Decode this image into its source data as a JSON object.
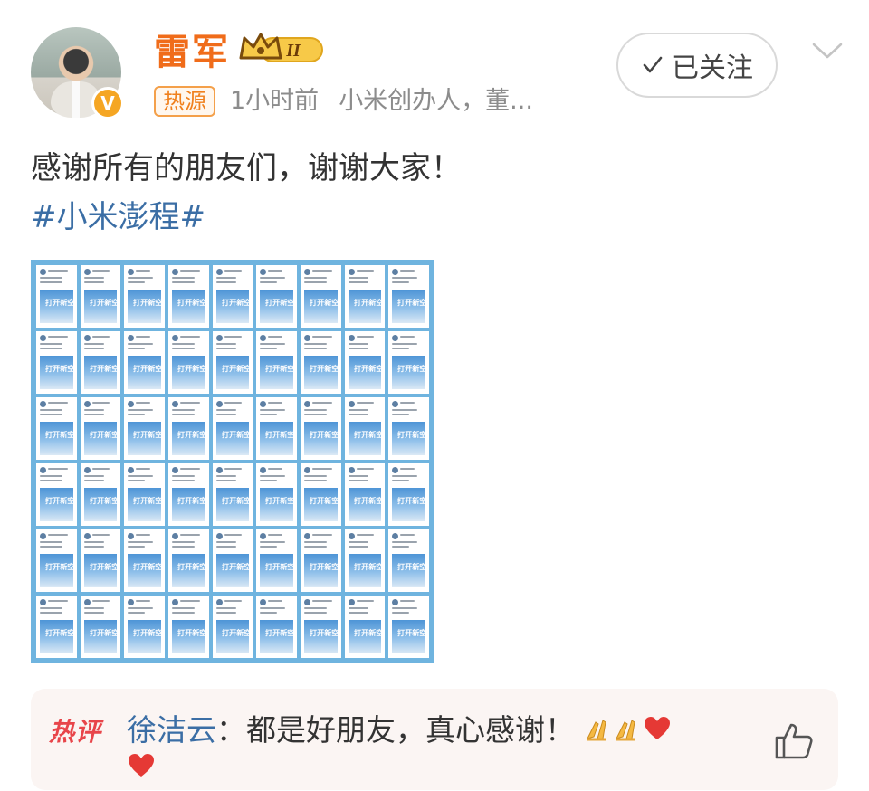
{
  "header": {
    "username": "雷军",
    "vip_level": "II",
    "hot_tag": "热源",
    "time": "1小时前",
    "description": "小米创办人，董...",
    "follow_label": "已关注"
  },
  "post": {
    "text": "感谢所有的朋友们，谢谢大家！",
    "hashtag": "#小米澎程#",
    "image_text": "打开新空间"
  },
  "hot_comment": {
    "label": "热评",
    "author": "徐洁云",
    "separator": "：",
    "text": "都是好朋友，真心感谢！"
  },
  "colors": {
    "brand_orange": "#f06c1a",
    "link_blue": "#3b6ea5",
    "hot_red": "#e8454a",
    "grid_border": "#6fb4df"
  },
  "icons": [
    "verified-icon",
    "vip-crown-icon",
    "check-icon",
    "chevron-down-icon",
    "pray-emoji",
    "heart-emoji",
    "thumbs-up-icon"
  ]
}
